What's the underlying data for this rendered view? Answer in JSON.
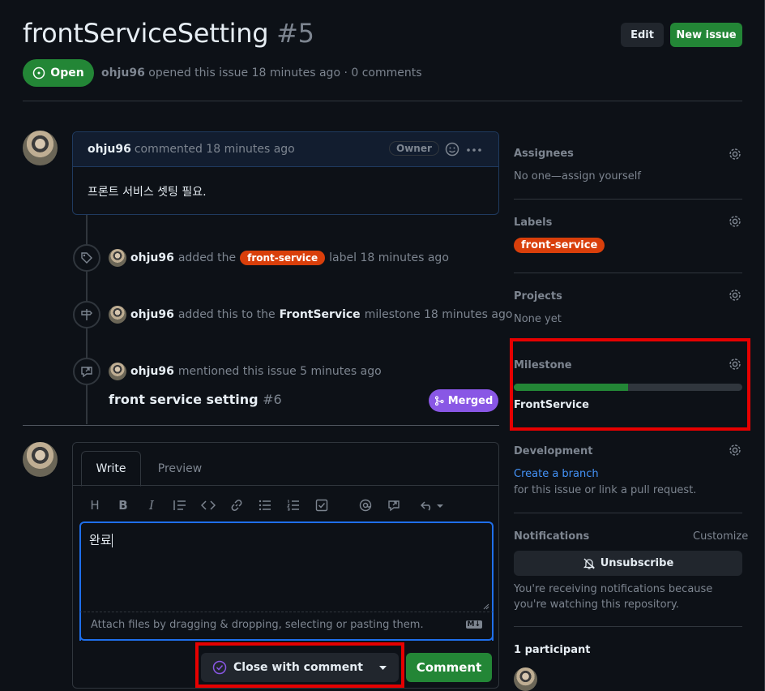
{
  "issue": {
    "title": "frontServiceSetting",
    "number": "#5",
    "state": "Open",
    "author": "ohju96",
    "meta_text": "opened this issue 18 minutes ago · 0 comments"
  },
  "header": {
    "edit_label": "Edit",
    "new_issue_label": "New issue"
  },
  "comment": {
    "author": "ohju96",
    "action": "commented 18 minutes ago",
    "role_badge": "Owner",
    "body": "프론트 서비스 셋팅 필요."
  },
  "timeline": [
    {
      "user": "ohju96",
      "pre": "added the",
      "label": "front-service",
      "post": "label 18 minutes ago"
    },
    {
      "user": "ohju96",
      "pre": "added this to the",
      "milestone": "FrontService",
      "post": "milestone 18 minutes ago"
    },
    {
      "user": "ohju96",
      "pre": "mentioned this issue 5 minutes ago",
      "ref_title": "front service setting",
      "ref_number": "#6",
      "ref_state": "Merged"
    }
  ],
  "editor": {
    "tab_write": "Write",
    "tab_preview": "Preview",
    "text": "완료",
    "attach_hint": "Attach files by dragging & dropping, selecting or pasting them.",
    "md_badge": "M↓",
    "close_label": "Close with comment",
    "comment_label": "Comment"
  },
  "sidebar": {
    "assignees": {
      "heading": "Assignees",
      "value": "No one—assign yourself"
    },
    "labels": {
      "heading": "Labels",
      "label": "front-service"
    },
    "projects": {
      "heading": "Projects",
      "value": "None yet"
    },
    "milestone": {
      "heading": "Milestone",
      "name": "FrontService",
      "progress_percent": 50
    },
    "development": {
      "heading": "Development",
      "link": "Create a branch",
      "text": "for this issue or link a pull request."
    },
    "notifications": {
      "heading": "Notifications",
      "customize": "Customize",
      "unsubscribe": "Unsubscribe",
      "text": "You're receiving notifications because you're watching this repository."
    },
    "participants": {
      "heading": "1 participant"
    }
  },
  "colors": {
    "open": "#238636",
    "label": "#d93f0b",
    "merged": "#8957e5",
    "highlight": "#e60000"
  }
}
